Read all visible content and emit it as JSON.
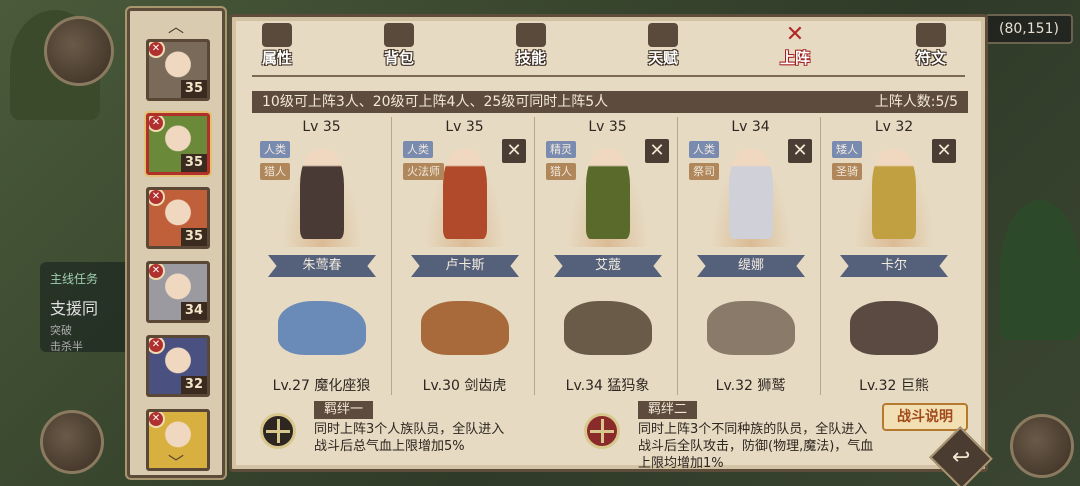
{
  "hud": {
    "coords": "(80,151)"
  },
  "quest": {
    "title": "主线任务",
    "name": "支援同",
    "desc_1": "突破",
    "desc_2": "击杀半"
  },
  "hero_list": [
    {
      "level": "35",
      "color": "#7a6a5a",
      "badge": "✕"
    },
    {
      "level": "35",
      "color": "#6a8a3a",
      "badge": "✕",
      "selected": true
    },
    {
      "level": "35",
      "color": "#c0603a",
      "badge": "✕"
    },
    {
      "level": "34",
      "color": "#9a9aa0",
      "badge": "✕"
    },
    {
      "level": "32",
      "color": "#4a5080",
      "badge": "✕"
    },
    {
      "level": "",
      "color": "#d8b040",
      "badge": "✕"
    }
  ],
  "tabs": [
    {
      "label": "属性",
      "icon": "fist-icon"
    },
    {
      "label": "背包",
      "icon": "backpack-icon"
    },
    {
      "label": "技能",
      "icon": "book-icon"
    },
    {
      "label": "天赋",
      "icon": "eye-icon"
    },
    {
      "label": "上阵",
      "icon": "crossed-swords-icon",
      "active": true
    },
    {
      "label": "符文",
      "icon": "rune-icon"
    }
  ],
  "rule": {
    "text": "10级可上阵3人、20级可上阵4人、25级可同时上阵5人",
    "count": "上阵人数:5/5"
  },
  "team": [
    {
      "level": "Lv 35",
      "race": "人类",
      "cls": "猎人",
      "name": "朱莺春",
      "removable": false,
      "hero_color": "#4a3a36",
      "pet_name": "Lv.27 魔化座狼",
      "pet_color": "#6a8ab8"
    },
    {
      "level": "Lv 35",
      "race": "人类",
      "cls": "火法师",
      "name": "卢卡斯",
      "removable": true,
      "hero_color": "#b04a2a",
      "pet_name": "Lv.30 剑齿虎",
      "pet_color": "#a86a3a"
    },
    {
      "level": "Lv 35",
      "race": "精灵",
      "cls": "猎人",
      "name": "艾蔻",
      "removable": true,
      "hero_color": "#5a6a2a",
      "pet_name": "Lv.34 猛犸象",
      "pet_color": "#6a5a48"
    },
    {
      "level": "Lv 34",
      "race": "人类",
      "cls": "祭司",
      "name": "缇娜",
      "removable": true,
      "hero_color": "#d0d0d8",
      "pet_name": "Lv.32 狮鹫",
      "pet_color": "#8a7a6a"
    },
    {
      "level": "Lv 32",
      "race": "矮人",
      "cls": "圣骑",
      "name": "卡尔",
      "removable": true,
      "hero_color": "#c0a040",
      "pet_name": "Lv.32 巨熊",
      "pet_color": "#5a4a42"
    }
  ],
  "bonds": [
    {
      "title": "羁绊一",
      "desc": "同时上阵3个人族队员，全队进入战斗后总气血上限增加5%"
    },
    {
      "title": "羁绊二",
      "desc": "同时上阵3个不同种族的队员，全队进入战斗后全队攻击，防御(物理,魔法)，气血上限均增加1%"
    }
  ],
  "battle_button": "战斗说明",
  "close_glyph": "✕",
  "scroll_up": "︿",
  "scroll_down": "﹀",
  "back_glyph": "↩"
}
